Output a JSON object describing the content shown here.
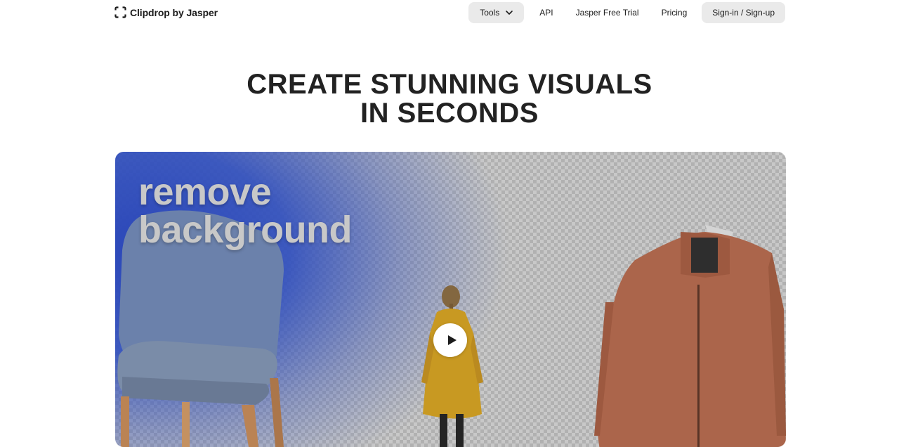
{
  "brand": {
    "name": "Clipdrop by Jasper"
  },
  "nav": {
    "tools_label": "Tools",
    "api_label": "API",
    "trial_label": "Jasper Free Trial",
    "pricing_label": "Pricing",
    "signin_label": "Sign-in / Sign-up"
  },
  "hero": {
    "line1": "CREATE STUNNING VISUALS",
    "line2": "IN SECONDS"
  },
  "video": {
    "caption_line1": "remove",
    "caption_line2": "background",
    "play_icon": "play-icon"
  },
  "colors": {
    "accent_blue": "#2646c8",
    "button_bg": "#eaeaea",
    "jacket": "#b8684a",
    "coat": "#d9a31c"
  }
}
